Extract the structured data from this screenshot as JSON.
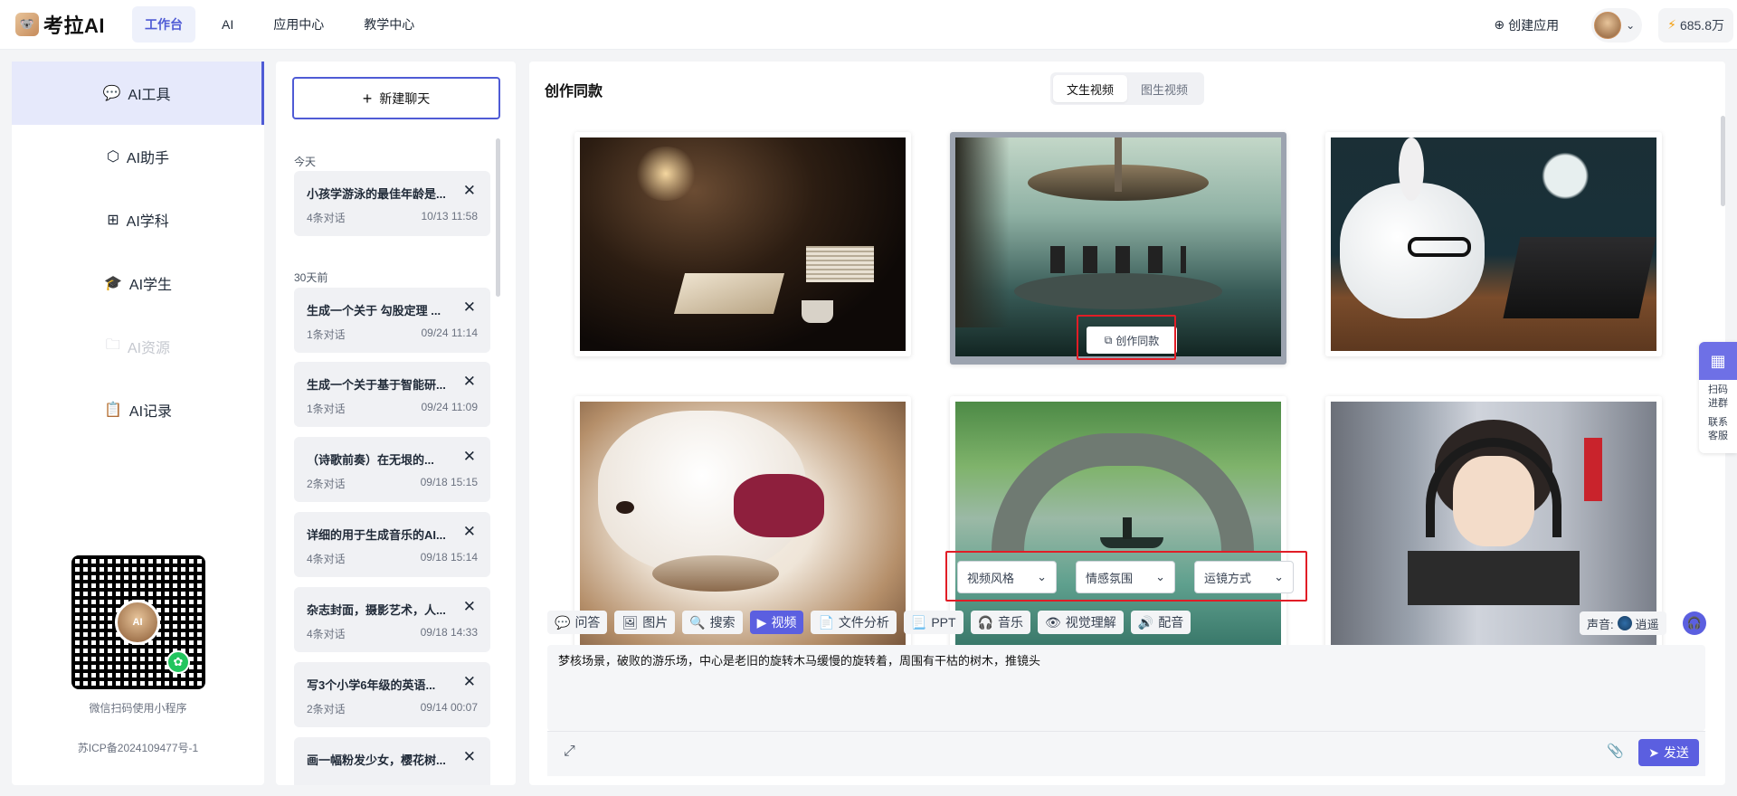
{
  "brand": {
    "logo_text": "考拉AI",
    "logo_icon": "koala-logo"
  },
  "nav": [
    {
      "label": "工作台",
      "active": true
    },
    {
      "label": "AI",
      "active": false
    },
    {
      "label": "应用中心",
      "active": false
    },
    {
      "label": "教学中心",
      "active": false
    }
  ],
  "header": {
    "create_app": "创建应用",
    "credits": "685.8万"
  },
  "sidebar": {
    "items": [
      {
        "label": "AI工具",
        "icon": "chat-bubble-icon",
        "active": true,
        "disabled": false
      },
      {
        "label": "AI助手",
        "icon": "cube-icon",
        "active": false,
        "disabled": false
      },
      {
        "label": "AI学科",
        "icon": "grid-icon",
        "active": false,
        "disabled": false
      },
      {
        "label": "AI学生",
        "icon": "graduation-cap-icon",
        "active": false,
        "disabled": false
      },
      {
        "label": "AI资源",
        "icon": "folder-icon",
        "active": false,
        "disabled": true
      },
      {
        "label": "AI记录",
        "icon": "clipboard-icon",
        "active": false,
        "disabled": false
      }
    ],
    "qr_center_text": "AI",
    "qr_caption": "微信扫码使用小程序",
    "icp": "苏ICP备2024109477号-1"
  },
  "chat": {
    "new_chat": "新建聊天",
    "groups": [
      {
        "label": "今天",
        "items": [
          {
            "title": "小孩学游泳的最佳年龄是...",
            "count": "4条对话",
            "time": "10/13 11:58"
          }
        ]
      },
      {
        "label": "30天前",
        "items": [
          {
            "title": "生成一个关于 勾股定理 ...",
            "count": "1条对话",
            "time": "09/24 11:14"
          },
          {
            "title": "生成一个关于基于智能研...",
            "count": "1条对话",
            "time": "09/24 11:09"
          },
          {
            "title": "（诗歌前奏）在无垠的...",
            "count": "2条对话",
            "time": "09/18 15:15"
          },
          {
            "title": "详细的用于生成音乐的AI...",
            "count": "4条对话",
            "time": "09/18 15:14"
          },
          {
            "title": "杂志封面，摄影艺术，人...",
            "count": "4条对话",
            "time": "09/18 14:33"
          },
          {
            "title": "写3个小学6年级的英语...",
            "count": "2条对话",
            "time": "09/14 00:07"
          },
          {
            "title": "画一幅粉发少女，樱花树...",
            "count": "",
            "time": ""
          }
        ]
      }
    ]
  },
  "main": {
    "title": "创作同款",
    "tabs": [
      {
        "label": "文生视频",
        "active": true
      },
      {
        "label": "图生视频",
        "active": false
      }
    ],
    "gallery": [
      {
        "name": "elderly-reader-image"
      },
      {
        "name": "carousel-image",
        "overlay": "创作同款"
      },
      {
        "name": "rabbit-laptop-image"
      },
      {
        "name": "puppy-eating-image"
      },
      {
        "name": "stone-bridge-image"
      },
      {
        "name": "anime-boy-image"
      }
    ],
    "dropdowns": [
      "视频风格",
      "情感氛围",
      "运镜方式"
    ]
  },
  "composer": {
    "tools": [
      {
        "label": "问答",
        "icon": "chat-icon",
        "active": false
      },
      {
        "label": "图片",
        "icon": "image-icon",
        "active": false
      },
      {
        "label": "搜索",
        "icon": "search-icon",
        "active": false
      },
      {
        "label": "视频",
        "icon": "video-icon",
        "active": true
      },
      {
        "label": "文件分析",
        "icon": "file-icon",
        "active": false
      },
      {
        "label": "PPT",
        "icon": "ppt-icon",
        "active": false
      },
      {
        "label": "音乐",
        "icon": "headphones-icon",
        "active": false
      },
      {
        "label": "视觉理解",
        "icon": "vision-icon",
        "active": false
      },
      {
        "label": "配音",
        "icon": "speaker-icon",
        "active": false
      }
    ],
    "voice_label": "声音:",
    "voice_name": "逍遥",
    "prompt": "梦核场景，破败的游乐场，中心是老旧的旋转木马缓慢的旋转着，周围有干枯的树木，推镜头",
    "send": "发送"
  },
  "float": {
    "line1": "扫码",
    "line2": "进群",
    "line3": "联系",
    "line4": "客服"
  },
  "colors": {
    "accent": "#5b5fe0",
    "highlight": "#e11d26"
  }
}
